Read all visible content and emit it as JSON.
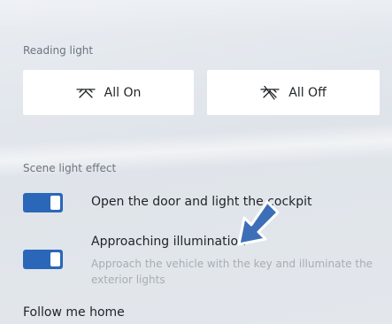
{
  "reading_light": {
    "title": "Reading light",
    "all_on_label": "All On",
    "all_off_label": "All Off",
    "all_on_icon": "light-beams-icon",
    "all_off_icon": "light-beams-off-icon"
  },
  "scene_light": {
    "title": "Scene light effect",
    "items": [
      {
        "label": "Open the door and light the cockpit",
        "enabled": true
      },
      {
        "label": "Approaching illumination",
        "description": "Approach the vehicle with the key and illuminate the exterior lights",
        "enabled": true
      }
    ],
    "next_item_label": "Follow me home"
  },
  "colors": {
    "toggle_on": "#2b67b8",
    "pointer_arrow": "#3d6fb8",
    "button_bg": "#ffffff"
  }
}
